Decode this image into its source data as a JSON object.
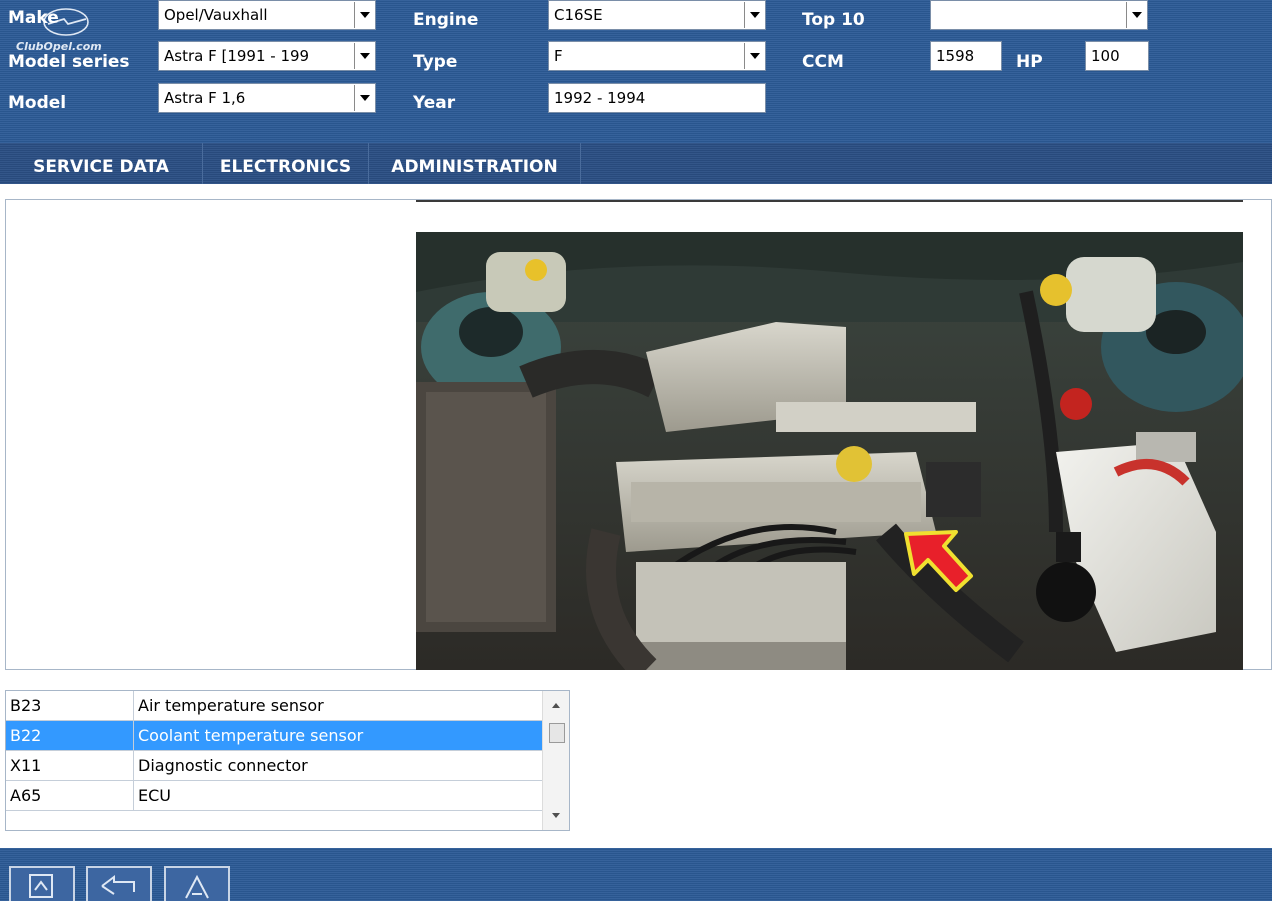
{
  "header": {
    "logo_text": "ClubOpel.com",
    "make_label": "Make",
    "make_value": "Opel/Vauxhall",
    "model_series_label": "Model series",
    "model_series_value": "Astra F [1991 - 199",
    "model_label": "Model",
    "model_value": "Astra F 1,6",
    "engine_label": "Engine",
    "engine_value": "C16SE",
    "type_label": "Type",
    "type_value": "F",
    "year_label": "Year",
    "year_value": "1992 - 1994",
    "top10_label": "Top 10",
    "top10_value": "",
    "ccm_label": "CCM",
    "ccm_value": "1598",
    "hp_label": "HP",
    "hp_value": "100"
  },
  "nav": {
    "tabs": [
      {
        "label": "SERVICE DATA"
      },
      {
        "label": "ELECTRONICS"
      },
      {
        "label": "ADMINISTRATION"
      }
    ]
  },
  "components": [
    {
      "code": "B23",
      "name": "Air temperature sensor"
    },
    {
      "code": "B22",
      "name": "Coolant temperature sensor"
    },
    {
      "code": "X11",
      "name": "Diagnostic connector"
    },
    {
      "code": "A65",
      "name": "ECU"
    }
  ],
  "selected_component": "B22",
  "footer": {
    "buttons": [
      {
        "icon": "save-icon"
      },
      {
        "icon": "back-icon"
      },
      {
        "icon": "up-icon"
      }
    ]
  },
  "colors": {
    "header_bg": "#2b5a96",
    "selection": "#3399ff",
    "highlight_arrow": "#e8202a"
  }
}
